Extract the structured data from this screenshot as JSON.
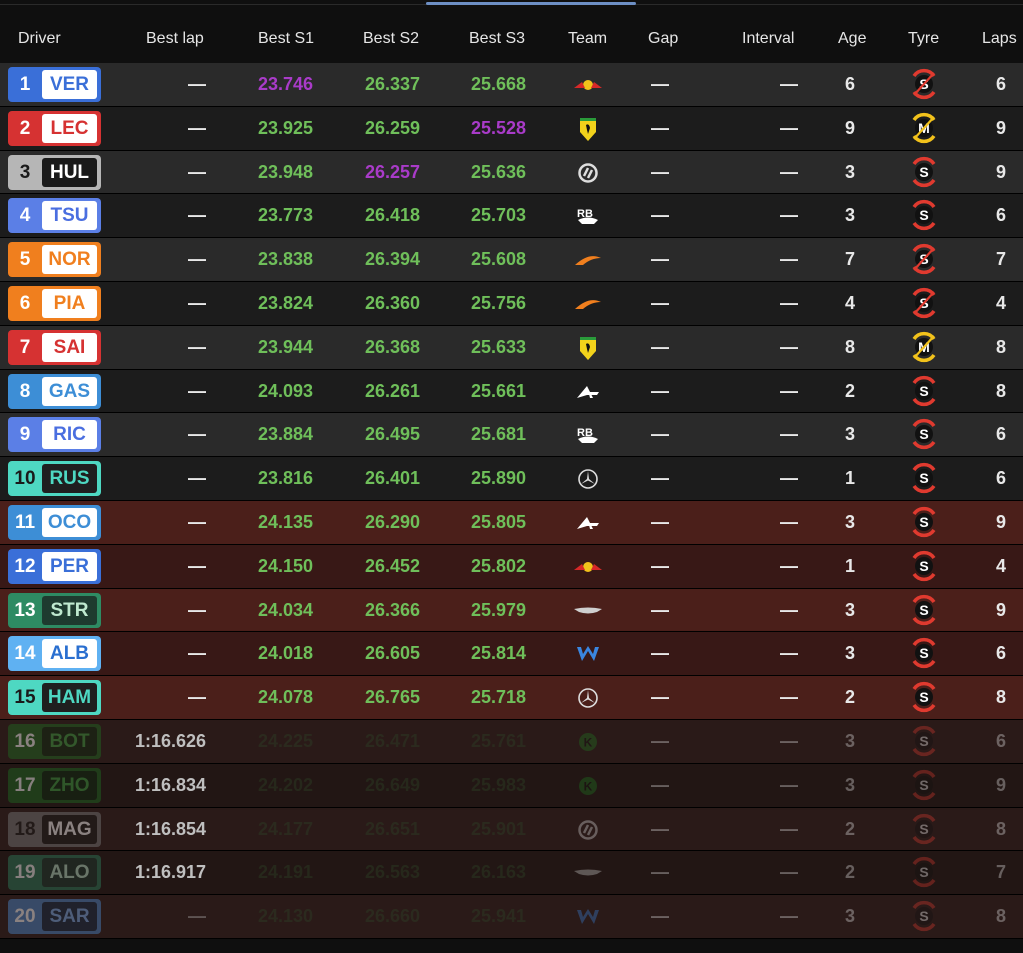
{
  "header": {
    "driver": "Driver",
    "best_lap": "Best lap",
    "best_s1": "Best S1",
    "best_s2": "Best S2",
    "best_s3": "Best S3",
    "team": "Team",
    "gap": "Gap",
    "interval": "Interval",
    "age": "Age",
    "tyre": "Tyre",
    "laps": "Laps"
  },
  "colors": {
    "sector_green": "#6fbf5a",
    "sector_purple": "#a93bc9",
    "dim_green": "#2f4a2a"
  },
  "rows": [
    {
      "pos": "1",
      "code": "VER",
      "team": "red-bull",
      "best_lap": "—",
      "s1": "23.746",
      "s2": "26.337",
      "s3": "25.668",
      "s1c": "purple",
      "s2c": "green",
      "s3c": "green",
      "gap": "—",
      "interval": "—",
      "age": "6",
      "tyre": "S",
      "tyre_used": true,
      "laps": "6",
      "bg": "g1",
      "color": "#3a6fd8",
      "code_color": "#3a6fd8",
      "faded": false
    },
    {
      "pos": "2",
      "code": "LEC",
      "team": "ferrari",
      "best_lap": "—",
      "s1": "23.925",
      "s2": "26.259",
      "s3": "25.528",
      "s1c": "green",
      "s2c": "green",
      "s3c": "purple",
      "gap": "—",
      "interval": "—",
      "age": "9",
      "tyre": "M",
      "tyre_used": true,
      "laps": "9",
      "bg": "g2",
      "color": "#d63232",
      "code_color": "#d63232",
      "faded": false
    },
    {
      "pos": "3",
      "code": "HUL",
      "team": "haas",
      "best_lap": "—",
      "s1": "23.948",
      "s2": "26.257",
      "s3": "25.636",
      "s1c": "green",
      "s2c": "purple",
      "s3c": "green",
      "gap": "—",
      "interval": "—",
      "age": "3",
      "tyre": "S",
      "tyre_used": false,
      "laps": "9",
      "bg": "g1",
      "color": "#b6b6b6",
      "code_color": "#1a1a1a",
      "faded": false
    },
    {
      "pos": "4",
      "code": "TSU",
      "team": "rb",
      "best_lap": "—",
      "s1": "23.773",
      "s2": "26.418",
      "s3": "25.703",
      "s1c": "green",
      "s2c": "green",
      "s3c": "green",
      "gap": "—",
      "interval": "—",
      "age": "3",
      "tyre": "S",
      "tyre_used": false,
      "laps": "6",
      "bg": "g2",
      "color": "#5b7fe6",
      "code_color": "#4a6ee0",
      "faded": false
    },
    {
      "pos": "5",
      "code": "NOR",
      "team": "mclaren",
      "best_lap": "—",
      "s1": "23.838",
      "s2": "26.394",
      "s3": "25.608",
      "s1c": "green",
      "s2c": "green",
      "s3c": "green",
      "gap": "—",
      "interval": "—",
      "age": "7",
      "tyre": "S",
      "tyre_used": true,
      "laps": "7",
      "bg": "g1",
      "color": "#f07f1e",
      "code_color": "#f07f1e",
      "faded": false
    },
    {
      "pos": "6",
      "code": "PIA",
      "team": "mclaren",
      "best_lap": "—",
      "s1": "23.824",
      "s2": "26.360",
      "s3": "25.756",
      "s1c": "green",
      "s2c": "green",
      "s3c": "green",
      "gap": "—",
      "interval": "—",
      "age": "4",
      "tyre": "S",
      "tyre_used": true,
      "laps": "4",
      "bg": "g2",
      "color": "#f07f1e",
      "code_color": "#f07f1e",
      "faded": false
    },
    {
      "pos": "7",
      "code": "SAI",
      "team": "ferrari",
      "best_lap": "—",
      "s1": "23.944",
      "s2": "26.368",
      "s3": "25.633",
      "s1c": "green",
      "s2c": "green",
      "s3c": "green",
      "gap": "—",
      "interval": "—",
      "age": "8",
      "tyre": "M",
      "tyre_used": true,
      "laps": "8",
      "bg": "g1",
      "color": "#d63232",
      "code_color": "#d63232",
      "faded": false
    },
    {
      "pos": "8",
      "code": "GAS",
      "team": "alpine",
      "best_lap": "—",
      "s1": "24.093",
      "s2": "26.261",
      "s3": "25.661",
      "s1c": "green",
      "s2c": "green",
      "s3c": "green",
      "gap": "—",
      "interval": "—",
      "age": "2",
      "tyre": "S",
      "tyre_used": false,
      "laps": "8",
      "bg": "g2",
      "color": "#3d8ed6",
      "code_color": "#3d8ed6",
      "faded": false
    },
    {
      "pos": "9",
      "code": "RIC",
      "team": "rb",
      "best_lap": "—",
      "s1": "23.884",
      "s2": "26.495",
      "s3": "25.681",
      "s1c": "green",
      "s2c": "green",
      "s3c": "green",
      "gap": "—",
      "interval": "—",
      "age": "3",
      "tyre": "S",
      "tyre_used": false,
      "laps": "6",
      "bg": "g1",
      "color": "#5b7fe6",
      "code_color": "#4a6ee0",
      "faded": false
    },
    {
      "pos": "10",
      "code": "RUS",
      "team": "mercedes",
      "best_lap": "—",
      "s1": "23.816",
      "s2": "26.401",
      "s3": "25.890",
      "s1c": "green",
      "s2c": "green",
      "s3c": "green",
      "gap": "—",
      "interval": "—",
      "age": "1",
      "tyre": "S",
      "tyre_used": false,
      "laps": "6",
      "bg": "g2",
      "color": "#4ed8c2",
      "code_color": "#1f1f1f",
      "faded": false
    },
    {
      "pos": "11",
      "code": "OCO",
      "team": "alpine",
      "best_lap": "—",
      "s1": "24.135",
      "s2": "26.290",
      "s3": "25.805",
      "s1c": "green",
      "s2c": "green",
      "s3c": "green",
      "gap": "—",
      "interval": "—",
      "age": "3",
      "tyre": "S",
      "tyre_used": false,
      "laps": "9",
      "bg": "r1",
      "color": "#3d8ed6",
      "code_color": "#3d8ed6",
      "faded": false
    },
    {
      "pos": "12",
      "code": "PER",
      "team": "red-bull",
      "best_lap": "—",
      "s1": "24.150",
      "s2": "26.452",
      "s3": "25.802",
      "s1c": "green",
      "s2c": "green",
      "s3c": "green",
      "gap": "—",
      "interval": "—",
      "age": "1",
      "tyre": "S",
      "tyre_used": false,
      "laps": "4",
      "bg": "r2",
      "color": "#3a6fd8",
      "code_color": "#3a6fd8",
      "faded": false
    },
    {
      "pos": "13",
      "code": "STR",
      "team": "aston-martin",
      "best_lap": "—",
      "s1": "24.034",
      "s2": "26.366",
      "s3": "25.979",
      "s1c": "green",
      "s2c": "green",
      "s3c": "green",
      "gap": "—",
      "interval": "—",
      "age": "3",
      "tyre": "S",
      "tyre_used": false,
      "laps": "9",
      "bg": "r1",
      "color": "#2e8b63",
      "code_color": "#2e8b63",
      "faded": false
    },
    {
      "pos": "14",
      "code": "ALB",
      "team": "williams",
      "best_lap": "—",
      "s1": "24.018",
      "s2": "26.605",
      "s3": "25.814",
      "s1c": "green",
      "s2c": "green",
      "s3c": "green",
      "gap": "—",
      "interval": "—",
      "age": "3",
      "tyre": "S",
      "tyre_used": false,
      "laps": "6",
      "bg": "r2",
      "color": "#5fb1f2",
      "code_color": "#2a6fd0",
      "faded": false
    },
    {
      "pos": "15",
      "code": "HAM",
      "team": "mercedes",
      "best_lap": "—",
      "s1": "24.078",
      "s2": "26.765",
      "s3": "25.718",
      "s1c": "green",
      "s2c": "green",
      "s3c": "green",
      "gap": "—",
      "interval": "—",
      "age": "2",
      "tyre": "S",
      "tyre_used": false,
      "laps": "8",
      "bg": "r1",
      "color": "#4ed8c2",
      "code_color": "#1f1f1f",
      "faded": false
    },
    {
      "pos": "16",
      "code": "BOT",
      "team": "kick-sauber",
      "best_lap": "1:16.626",
      "s1": "24.225",
      "s2": "26.471",
      "s3": "25.761",
      "s1c": "dim",
      "s2c": "dim",
      "s3c": "dim",
      "gap": "—",
      "interval": "—",
      "age": "3",
      "tyre": "S",
      "tyre_used": false,
      "laps": "6",
      "bg": "e1",
      "color": "#1f6b22",
      "code_color": "#1f6b22",
      "faded": true
    },
    {
      "pos": "17",
      "code": "ZHO",
      "team": "kick-sauber",
      "best_lap": "1:16.834",
      "s1": "24.202",
      "s2": "26.649",
      "s3": "25.983",
      "s1c": "dim",
      "s2c": "dim",
      "s3c": "dim",
      "gap": "—",
      "interval": "—",
      "age": "3",
      "tyre": "S",
      "tyre_used": false,
      "laps": "9",
      "bg": "e2",
      "color": "#1f6b22",
      "code_color": "#1f6b22",
      "faded": true
    },
    {
      "pos": "18",
      "code": "MAG",
      "team": "haas",
      "best_lap": "1:16.854",
      "s1": "24.177",
      "s2": "26.651",
      "s3": "25.901",
      "s1c": "dim",
      "s2c": "dim",
      "s3c": "dim",
      "gap": "—",
      "interval": "—",
      "age": "2",
      "tyre": "S",
      "tyre_used": false,
      "laps": "8",
      "bg": "e1",
      "color": "#777",
      "code_color": "#1a1a1a",
      "faded": true
    },
    {
      "pos": "19",
      "code": "ALO",
      "team": "aston-martin",
      "best_lap": "1:16.917",
      "s1": "24.191",
      "s2": "26.563",
      "s3": "26.163",
      "s1c": "dim",
      "s2c": "dim",
      "s3c": "dim",
      "gap": "—",
      "interval": "—",
      "age": "2",
      "tyre": "S",
      "tyre_used": false,
      "laps": "7",
      "bg": "e2",
      "color": "#2e7d5b",
      "code_color": "#2e7d5b",
      "faded": true
    },
    {
      "pos": "20",
      "code": "SAR",
      "team": "williams",
      "best_lap": "—",
      "s1": "24.130",
      "s2": "26.660",
      "s3": "25.941",
      "s1c": "dim",
      "s2c": "dim",
      "s3c": "dim",
      "gap": "—",
      "interval": "—",
      "age": "3",
      "tyre": "S",
      "tyre_used": false,
      "laps": "8",
      "bg": "e1",
      "color": "#4a86c8",
      "code_color": "#2a6fd0",
      "faded": true
    }
  ]
}
